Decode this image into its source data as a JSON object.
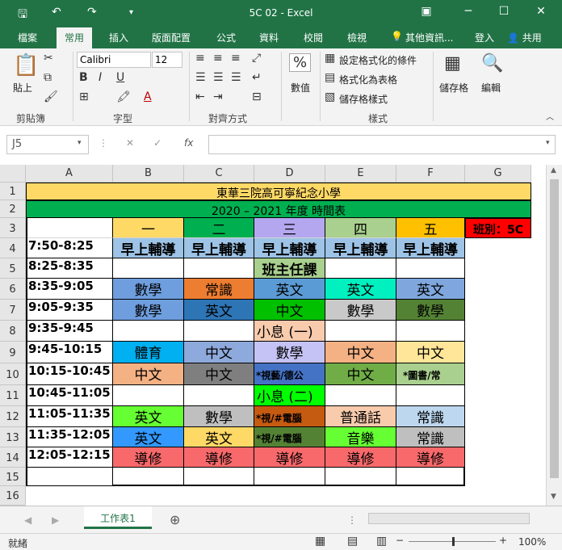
{
  "title_bar": {
    "title": "5C 02 - Excel"
  },
  "tabs": [
    "檔案",
    "常用",
    "插入",
    "版面配置",
    "公式",
    "資料",
    "校閱",
    "檢視",
    "其他資訊..."
  ],
  "account": {
    "signin": "登入",
    "share": "共用"
  },
  "ribbon": {
    "paste_label": "貼上",
    "font_name": "Calibri",
    "font_size": "12",
    "number_label": "數值",
    "cond_format": "設定格式化的條件",
    "format_table": "格式化為表格",
    "cell_styles": "儲存格樣式",
    "storage_label": "儲存格",
    "edit_label": "編輯",
    "groups": {
      "clipboard": "剪貼簿",
      "font": "字型",
      "align": "對齊方式",
      "styles": "樣式"
    }
  },
  "formula": {
    "namebox": "J5",
    "fx": "fx",
    "content": ""
  },
  "columns": [
    "A",
    "B",
    "C",
    "D",
    "E",
    "F",
    "G"
  ],
  "rows": [
    "1",
    "2",
    "3",
    "4",
    "5",
    "6",
    "7",
    "8",
    "9",
    "10",
    "11",
    "12",
    "13",
    "14",
    "15",
    "16"
  ],
  "sheet": {
    "school": "東華三院高可寧紀念小學",
    "year": "2020 – 2021 年度  時間表",
    "class": "班別：5C",
    "days": [
      "一",
      "二",
      "三",
      "四",
      "五"
    ],
    "times": [
      "7:50-8:25",
      "8:25-8:35",
      "8:35-9:05",
      "9:05-9:35",
      "9:35-9:45",
      "9:45-10:15",
      "10:15-10:45",
      "10:45-11:05",
      "11:05-11:35",
      "11:35-12:05",
      "12:05-12:15"
    ],
    "r4": [
      "早上輔導",
      "早上輔導",
      "早上輔導",
      "早上輔導",
      "早上輔導"
    ],
    "r5d": "班主任課",
    "r6": [
      "數學",
      "常識",
      "英文",
      "英文",
      "英文"
    ],
    "r7": [
      "數學",
      "英文",
      "中文",
      "數學",
      "數學"
    ],
    "r8d": "小息 (一)",
    "r9": [
      "體育",
      "中文",
      "數學",
      "中文",
      "中文"
    ],
    "r10": [
      "中文",
      "中文",
      "*視藝/德公",
      "中文",
      "*圖書/常"
    ],
    "r11d": "小息 (二)",
    "r12": [
      "英文",
      "數學",
      "*視/#電腦",
      "普通話",
      "常識"
    ],
    "r13": [
      "英文",
      "英文",
      "*視/#電腦",
      "音樂",
      "常識"
    ],
    "r14": [
      "導修",
      "導修",
      "導修",
      "導修",
      "導修"
    ]
  },
  "sheet_tab": "工作表1",
  "status": {
    "ready": "就緒",
    "zoom": "100%"
  },
  "colors": {
    "excel_green": "#217346"
  }
}
